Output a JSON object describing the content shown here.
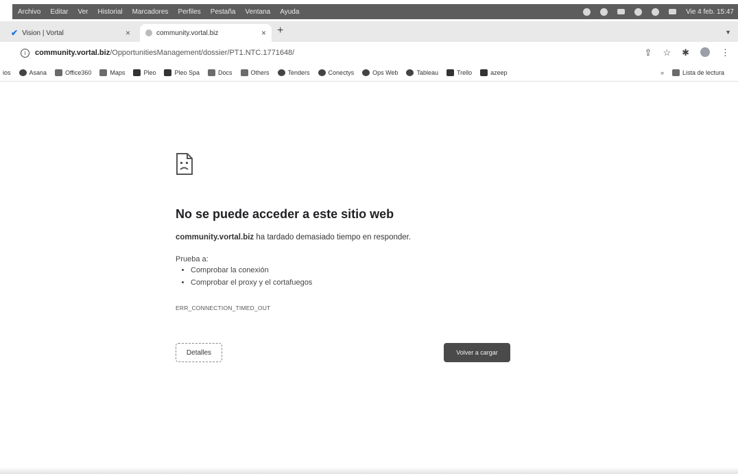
{
  "menubar": {
    "items": [
      "Archivo",
      "Editar",
      "Ver",
      "Historial",
      "Marcadores",
      "Perfiles",
      "Pestaña",
      "Ventana",
      "Ayuda"
    ],
    "clock": "Vie 4 feb. 15:47"
  },
  "tabs": [
    {
      "label": "Vision | Vortal",
      "close": "×",
      "active": false
    },
    {
      "label": "community.vortal.biz",
      "close": "×",
      "active": true
    }
  ],
  "new_tab": "+",
  "address": {
    "host": "community.vortal.biz",
    "path": "/OpportunitiesManagement/dossier/PT1.NTC.1771648/"
  },
  "bookmarks": {
    "items": [
      "ios",
      "Asana",
      "Office360",
      "Maps",
      "Pleo",
      "Pleo Spa",
      "Docs",
      "Others",
      "Tenders",
      "Conectys",
      "Ops Web",
      "Tableau",
      "Trello",
      "azeep"
    ],
    "more": "»",
    "reading_list": "Lista de lectura"
  },
  "error": {
    "title": "No se puede acceder a este sitio web",
    "domain": "community.vortal.biz",
    "description": " ha tardado demasiado tiempo en responder.",
    "try_label": "Prueba a:",
    "suggestions": [
      "Comprobar la conexión",
      "Comprobar el proxy y el cortafuegos"
    ],
    "code": "ERR_CONNECTION_TIMED_OUT",
    "details_button": "Detalles",
    "reload_button": "Volver a cargar"
  },
  "colors": {
    "menubar_bg": "#5d5d5d",
    "reload_button_bg": "#4a4a4a",
    "title_color": "#202124"
  }
}
